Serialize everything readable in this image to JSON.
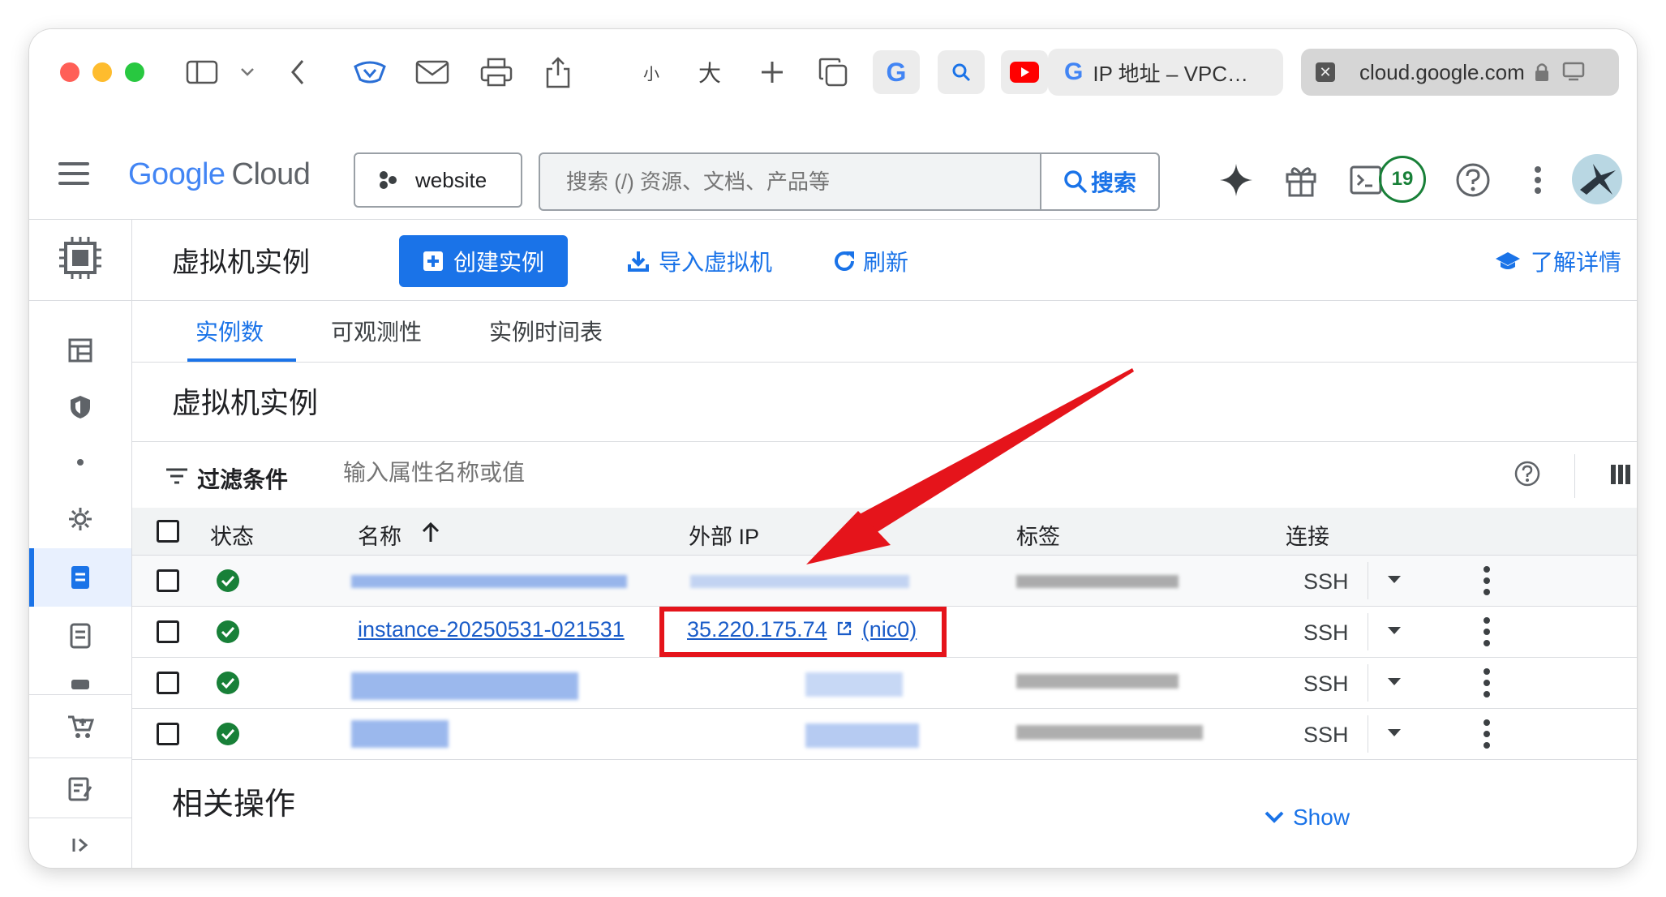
{
  "browser": {
    "toolbar_small_font": "小",
    "toolbar_large_font": "大",
    "tabs": [
      {
        "label": "IP 地址 – VPC…"
      },
      {
        "label": "cloud.google.com",
        "active": true
      }
    ]
  },
  "header": {
    "logo_google": "Google",
    "logo_cloud": "Cloud",
    "project": "website",
    "search_placeholder": "搜索 (/) 资源、文档、产品等",
    "search_button": "搜索",
    "notification_count": "19"
  },
  "page": {
    "title": "虚拟机实例",
    "create_button": "创建实例",
    "import_button": "导入虚拟机",
    "refresh_button": "刷新",
    "learn_more": "了解详情"
  },
  "tabs": [
    "实例数",
    "可观测性",
    "实例时间表"
  ],
  "section_title": "虚拟机实例",
  "filter": {
    "label": "过滤条件",
    "placeholder": "输入属性名称或值"
  },
  "table": {
    "columns": [
      "状态",
      "名称",
      "外部 IP",
      "标签",
      "连接"
    ],
    "rows": [
      {
        "name": "",
        "ip": "",
        "connect": "SSH"
      },
      {
        "name": "instance-20250531-021531",
        "ip": "35.220.175.74",
        "nic": "(nic0)",
        "connect": "SSH"
      },
      {
        "name": "",
        "ip": "",
        "connect": "SSH"
      },
      {
        "name": "",
        "ip": "",
        "connect": "SSH"
      }
    ]
  },
  "related": {
    "title": "相关操作",
    "show": "Show"
  },
  "colors": {
    "accent": "#1a73e8",
    "highlight": "#e5141b",
    "status_ok": "#188038"
  }
}
